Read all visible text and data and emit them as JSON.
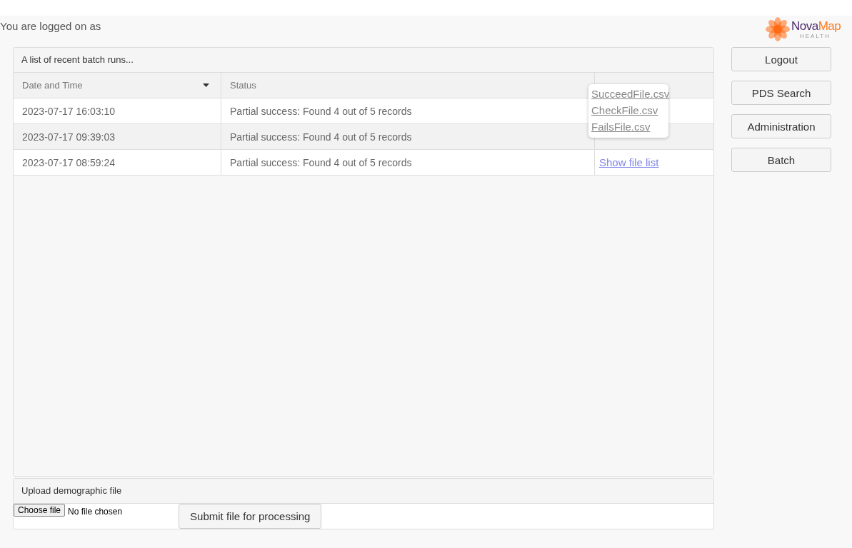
{
  "header": {
    "logged_on": "You are logged on as"
  },
  "logo": {
    "name_first": "Nova",
    "name_second": "Map",
    "tagline": "HEALTH"
  },
  "batch_panel": {
    "title": "A list of recent batch runs...",
    "columns": [
      {
        "label": "Date and Time",
        "sorted": true
      },
      {
        "label": "Status",
        "sorted": false
      }
    ],
    "rows": [
      {
        "date_time": "2023-07-17 16:03:10",
        "status": "Partial success: Found 4 out of 5 records"
      },
      {
        "date_time": "2023-07-17 09:39:03",
        "status": "Partial success: Found 4 out of 5 records"
      },
      {
        "date_time": "2023-07-17 08:59:24",
        "status": "Partial success: Found 4 out of 5 records",
        "link": "Show file list"
      }
    ]
  },
  "file_popup": {
    "files": [
      "SucceedFile.csv",
      "CheckFile.csv",
      "FailsFile.csv"
    ]
  },
  "upload_panel": {
    "title": "Upload demographic file",
    "choose_button": "Choose file",
    "file_status": "No file chosen",
    "submit_button": "Submit file for processing"
  },
  "nav_buttons": [
    "Logout",
    "PDS Search",
    "Administration",
    "Batch"
  ]
}
